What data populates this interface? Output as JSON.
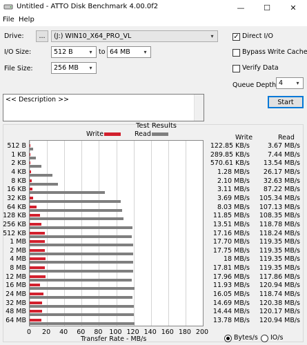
{
  "window": {
    "title": "Untitled - ATTO Disk Benchmark 4.00.0f2",
    "minimize_glyph": "—",
    "maximize_glyph": "☐",
    "close_glyph": "✕"
  },
  "menu": {
    "file": "File",
    "help": "Help"
  },
  "controls": {
    "drive_label": "Drive:",
    "browse_label": "...",
    "drive_value": "(J:) WIN10_X64_PRO_VL",
    "io_size_label": "I/O Size:",
    "io_size_from": "512 B",
    "to_label": "to",
    "io_size_to": "64 MB",
    "file_size_label": "File Size:",
    "file_size_value": "256 MB",
    "direct_io_label": "Direct I/O",
    "direct_io_checked": true,
    "bypass_write_cache_label": "Bypass Write Cache",
    "bypass_write_cache_checked": false,
    "verify_data_label": "Verify Data",
    "verify_data_checked": false,
    "queue_depth_label": "Queue Depth:",
    "queue_depth_value": "4",
    "start_label": "Start",
    "description_text": "<< Description >>"
  },
  "results": {
    "title": "Test Results",
    "write_legend": "Write",
    "read_legend": "Read",
    "write_header": "Write",
    "read_header": "Read",
    "x_axis_label": "Transfer Rate - MB/s",
    "x_ticks": [
      "0",
      "20",
      "40",
      "60",
      "80",
      "100",
      "120",
      "140",
      "160",
      "180",
      "200"
    ],
    "units_bytes_label": "Bytes/s",
    "units_io_label": "IO/s",
    "units_selected": "Bytes/s",
    "write_color": "#d2202e",
    "read_color": "#7f7f7f"
  },
  "chart_data": {
    "type": "bar",
    "orientation": "horizontal",
    "title": "Test Results",
    "xlabel": "Transfer Rate - MB/s",
    "xlim": [
      0,
      200
    ],
    "grid": true,
    "legend": "top-center",
    "categories": [
      "512 B",
      "1 KB",
      "2 KB",
      "4 KB",
      "8 KB",
      "16 KB",
      "32 KB",
      "64 KB",
      "128 KB",
      "256 KB",
      "512 KB",
      "1 MB",
      "2 MB",
      "4 MB",
      "8 MB",
      "12 MB",
      "16 MB",
      "24 MB",
      "32 MB",
      "48 MB",
      "64 MB"
    ],
    "series": [
      {
        "name": "Write",
        "values": [
          0.12,
          0.28,
          0.56,
          1.28,
          2.1,
          3.11,
          3.69,
          8.03,
          11.85,
          13.51,
          17.16,
          17.7,
          17.75,
          18.0,
          17.81,
          17.96,
          11.93,
          16.05,
          14.69,
          14.44,
          13.78
        ],
        "labels": [
          "122.85 KB/s",
          "289.85 KB/s",
          "570.61 KB/s",
          "1.28 MB/s",
          "2.10 MB/s",
          "3.11 MB/s",
          "3.69 MB/s",
          "8.03 MB/s",
          "11.85 MB/s",
          "13.51 MB/s",
          "17.16 MB/s",
          "17.70 MB/s",
          "17.75 MB/s",
          "18 MB/s",
          "17.81 MB/s",
          "17.96 MB/s",
          "11.93 MB/s",
          "16.05 MB/s",
          "14.69 MB/s",
          "14.44 MB/s",
          "13.78 MB/s"
        ]
      },
      {
        "name": "Read",
        "values": [
          3.67,
          7.44,
          13.54,
          26.17,
          32.63,
          87.22,
          105.34,
          107.13,
          108.35,
          118.78,
          118.24,
          119.35,
          119.35,
          119.35,
          119.35,
          117.86,
          120.94,
          118.74,
          120.38,
          120.17,
          120.94
        ],
        "labels": [
          "3.67 MB/s",
          "7.44 MB/s",
          "13.54 MB/s",
          "26.17 MB/s",
          "32.63 MB/s",
          "87.22 MB/s",
          "105.34 MB/s",
          "107.13 MB/s",
          "108.35 MB/s",
          "118.78 MB/s",
          "118.24 MB/s",
          "119.35 MB/s",
          "119.35 MB/s",
          "119.35 MB/s",
          "119.35 MB/s",
          "117.86 MB/s",
          "120.94 MB/s",
          "118.74 MB/s",
          "120.38 MB/s",
          "120.17 MB/s",
          "120.94 MB/s"
        ]
      }
    ]
  }
}
